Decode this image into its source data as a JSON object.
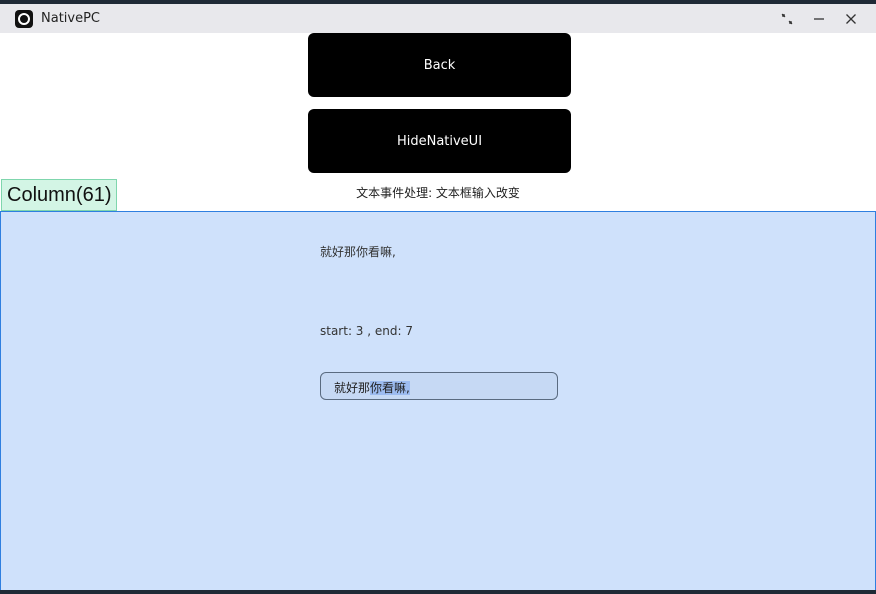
{
  "window": {
    "title": "NativePC"
  },
  "buttons": {
    "back": "Back",
    "hide_native_ui": "HideNativeUI"
  },
  "caption": "文本事件处理: 文本框输入改变",
  "column_badge": "Column(61)",
  "panel": {
    "echo_text": "就好那你看嘛,",
    "selection_status": "start: 3 , end: 7",
    "input": {
      "value_unselected": "就好那",
      "value_selected": "你看嘛,"
    }
  },
  "colors": {
    "panel_bg": "#cfe1fb",
    "panel_border": "#2f7fe0",
    "badge_bg": "#d3f5e5",
    "button_bg": "#000000"
  }
}
